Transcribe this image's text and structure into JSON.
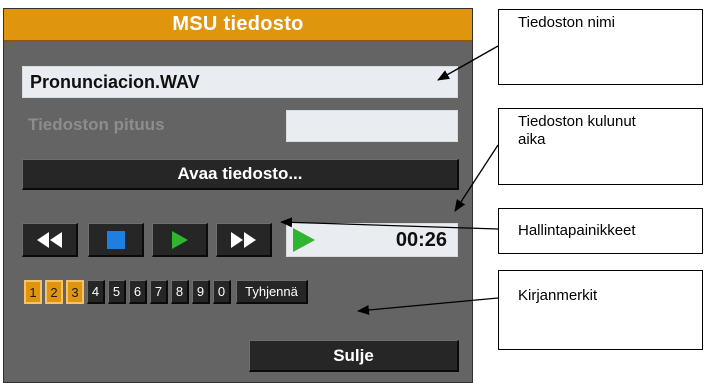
{
  "window": {
    "title": "MSU tiedosto",
    "file_name": "Pronunciacion.WAV",
    "length_label": "Tiedoston pituus",
    "length_value": "",
    "open_button": "Avaa tiedosto...",
    "elapsed_time": "00:26",
    "close_button": "Sulje",
    "bookmarks": [
      {
        "label": "1",
        "active": true
      },
      {
        "label": "2",
        "active": true
      },
      {
        "label": "3",
        "active": true
      },
      {
        "label": "4",
        "active": false
      },
      {
        "label": "5",
        "active": false
      },
      {
        "label": "6",
        "active": false
      },
      {
        "label": "7",
        "active": false
      },
      {
        "label": "8",
        "active": false
      },
      {
        "label": "9",
        "active": false
      },
      {
        "label": "0",
        "active": false
      }
    ],
    "clear_button": "Tyhjennä"
  },
  "callouts": {
    "file_name": "Tiedoston nimi",
    "elapsed_line1": "Tiedoston kulunut",
    "elapsed_line2": "aika",
    "controls": "Hallintapainikkeet",
    "bookmarks": "Kirjanmerkit"
  },
  "colors": {
    "title_bar": "#e0950f",
    "panel": "#646464",
    "button": "#262626",
    "play_green": "#2fb52f",
    "stop_blue": "#1f7fe0",
    "bookmark_active": "#e0950f"
  },
  "icons": {
    "rewind": "rewind-icon",
    "stop": "stop-icon",
    "play": "play-icon",
    "fast_forward": "fast-forward-icon",
    "status": "playing-status-icon"
  }
}
